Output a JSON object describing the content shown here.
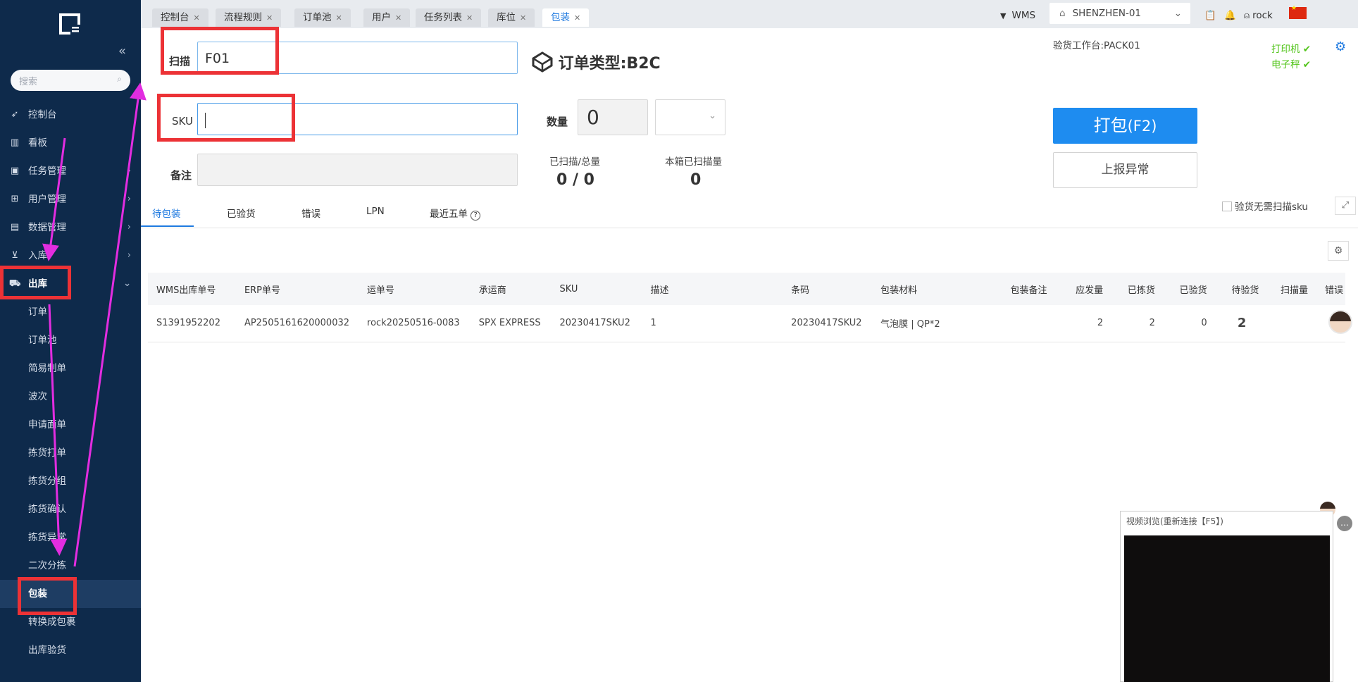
{
  "sidebar": {
    "search_placeholder": "搜索",
    "menu": [
      {
        "label": "控制台",
        "icon": "rocket-icon"
      },
      {
        "label": "看板",
        "icon": "bar-chart-icon"
      },
      {
        "label": "任务管理",
        "icon": "box-icon"
      },
      {
        "label": "用户管理",
        "icon": "users-icon"
      },
      {
        "label": "数据管理",
        "icon": "database-icon"
      },
      {
        "label": "入库",
        "icon": "cart-icon"
      },
      {
        "label": "出库",
        "icon": "truck-icon"
      }
    ],
    "submenu": [
      "订单",
      "订单池",
      "简易制单",
      "波次",
      "申请面单",
      "拣货打单",
      "拣货分组",
      "拣货确认",
      "拣货异常",
      "二次分拣",
      "包装",
      "转换成包裹",
      "出库验货"
    ]
  },
  "tabs": [
    {
      "label": "控制台"
    },
    {
      "label": "流程规则"
    },
    {
      "label": "订单池"
    },
    {
      "label": "用户"
    },
    {
      "label": "任务列表"
    },
    {
      "label": "库位"
    },
    {
      "label": "包装"
    }
  ],
  "header": {
    "system": "WMS",
    "warehouse": "SHENZHEN-01",
    "user": "rock"
  },
  "form": {
    "scan_label": "扫描",
    "scan_value": "F01",
    "sku_label": "SKU",
    "sku_value": "",
    "remark_label": "备注",
    "order_type": "订单类型:B2C",
    "qty_label": "数量",
    "qty_value": "0",
    "scanned_total_label": "已扫描/总量",
    "scanned_total_value": "0 / 0",
    "box_scanned_label": "本箱已扫描量",
    "box_scanned_value": "0",
    "workstation": "验货工作台:PACK01",
    "printer": "打印机",
    "scale": "电子秤",
    "pack_btn": "打包",
    "pack_shortcut": "(F2)",
    "report_btn": "上报异常",
    "no_scan_sku": "验货无需扫描sku"
  },
  "subtabs": [
    "待包装",
    "已验货",
    "错误",
    "LPN",
    "最近五单"
  ],
  "table": {
    "headers": [
      "WMS出库单号",
      "ERP单号",
      "运单号",
      "承运商",
      "SKU",
      "描述",
      "条码",
      "包装材料",
      "包装备注",
      "应发量",
      "已拣货",
      "已验货",
      "待验货",
      "扫描量",
      "错误"
    ],
    "rows": [
      [
        "S1391952202",
        "AP2505161620000032",
        "rock20250516-0083",
        "SPX EXPRESS",
        "20230417SKU2",
        "1",
        "20230417SKU2",
        "气泡膜 | QP*2",
        "",
        "2",
        "2",
        "0",
        "2",
        "",
        ""
      ]
    ]
  },
  "video": {
    "title": "视频浏览(重新连接【F5】)"
  }
}
